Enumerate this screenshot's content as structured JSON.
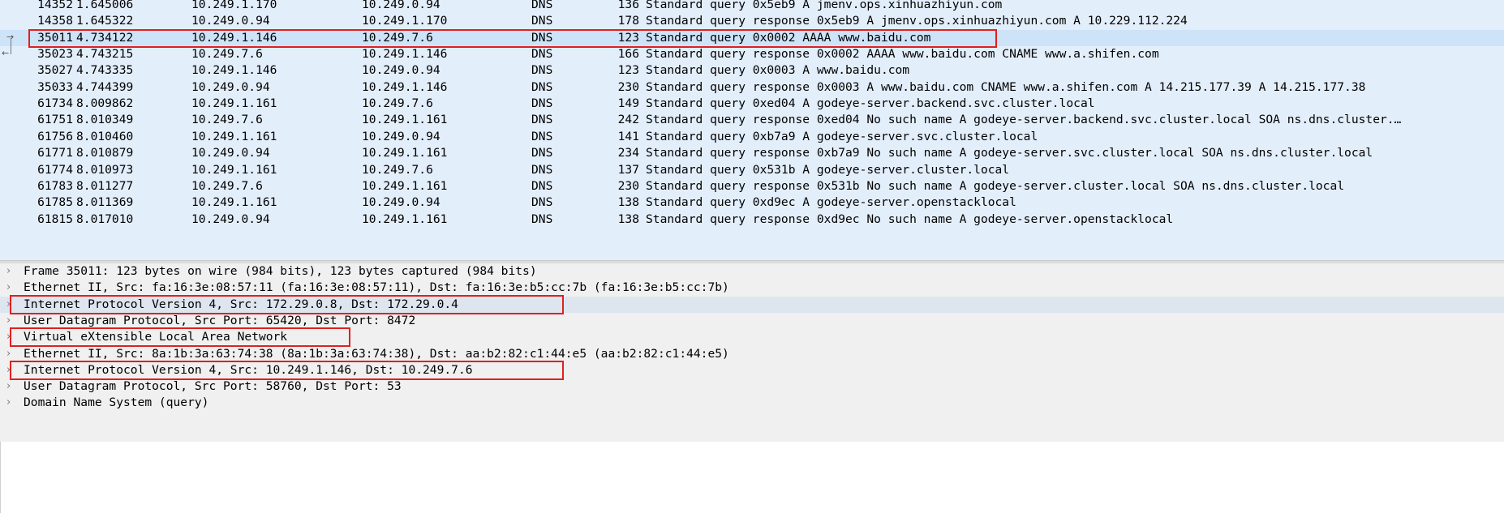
{
  "packet_list": {
    "rows": [
      {
        "no": "14352",
        "time": "1.645006",
        "src": "10.249.1.170",
        "dst": "10.249.0.94",
        "proto": "DNS",
        "len": "136",
        "info": "Standard query 0x5eb9 A jmenv.ops.xinhuazhiyun.com"
      },
      {
        "no": "14358",
        "time": "1.645322",
        "src": "10.249.0.94",
        "dst": "10.249.1.170",
        "proto": "DNS",
        "len": "178",
        "info": "Standard query response 0x5eb9 A jmenv.ops.xinhuazhiyun.com A 10.229.112.224"
      },
      {
        "no": "35011",
        "time": "4.734122",
        "src": "10.249.1.146",
        "dst": "10.249.7.6",
        "proto": "DNS",
        "len": "123",
        "info": "Standard query 0x0002 AAAA www.baidu.com",
        "selected": true
      },
      {
        "no": "35023",
        "time": "4.743215",
        "src": "10.249.7.6",
        "dst": "10.249.1.146",
        "proto": "DNS",
        "len": "166",
        "info": "Standard query response 0x0002 AAAA www.baidu.com CNAME www.a.shifen.com"
      },
      {
        "no": "35027",
        "time": "4.743335",
        "src": "10.249.1.146",
        "dst": "10.249.0.94",
        "proto": "DNS",
        "len": "123",
        "info": "Standard query 0x0003 A www.baidu.com"
      },
      {
        "no": "35033",
        "time": "4.744399",
        "src": "10.249.0.94",
        "dst": "10.249.1.146",
        "proto": "DNS",
        "len": "230",
        "info": "Standard query response 0x0003 A www.baidu.com CNAME www.a.shifen.com A 14.215.177.39 A 14.215.177.38"
      },
      {
        "no": "61734",
        "time": "8.009862",
        "src": "10.249.1.161",
        "dst": "10.249.7.6",
        "proto": "DNS",
        "len": "149",
        "info": "Standard query 0xed04 A godeye-server.backend.svc.cluster.local"
      },
      {
        "no": "61751",
        "time": "8.010349",
        "src": "10.249.7.6",
        "dst": "10.249.1.161",
        "proto": "DNS",
        "len": "242",
        "info": "Standard query response 0xed04 No such name A godeye-server.backend.svc.cluster.local SOA ns.dns.cluster.…"
      },
      {
        "no": "61756",
        "time": "8.010460",
        "src": "10.249.1.161",
        "dst": "10.249.0.94",
        "proto": "DNS",
        "len": "141",
        "info": "Standard query 0xb7a9 A godeye-server.svc.cluster.local"
      },
      {
        "no": "61771",
        "time": "8.010879",
        "src": "10.249.0.94",
        "dst": "10.249.1.161",
        "proto": "DNS",
        "len": "234",
        "info": "Standard query response 0xb7a9 No such name A godeye-server.svc.cluster.local SOA ns.dns.cluster.local"
      },
      {
        "no": "61774",
        "time": "8.010973",
        "src": "10.249.1.161",
        "dst": "10.249.7.6",
        "proto": "DNS",
        "len": "137",
        "info": "Standard query 0x531b A godeye-server.cluster.local"
      },
      {
        "no": "61783",
        "time": "8.011277",
        "src": "10.249.7.6",
        "dst": "10.249.1.161",
        "proto": "DNS",
        "len": "230",
        "info": "Standard query response 0x531b No such name A godeye-server.cluster.local SOA ns.dns.cluster.local"
      },
      {
        "no": "61785",
        "time": "8.011369",
        "src": "10.249.1.161",
        "dst": "10.249.0.94",
        "proto": "DNS",
        "len": "138",
        "info": "Standard query 0xd9ec A godeye-server.openstacklocal"
      },
      {
        "no": "61815",
        "time": "8.017010",
        "src": "10.249.0.94",
        "dst": "10.249.1.161",
        "proto": "DNS",
        "len": "138",
        "info": "Standard query response 0xd9ec No such name A godeye-server.openstacklocal"
      }
    ],
    "relation_icons": {
      "request_arrow": "→",
      "response_arrow": "←"
    }
  },
  "details": {
    "rows": [
      {
        "text": "Frame 35011: 123 bytes on wire (984 bits), 123 bytes captured (984 bits)"
      },
      {
        "text": "Ethernet II, Src: fa:16:3e:08:57:11 (fa:16:3e:08:57:11), Dst: fa:16:3e:b5:cc:7b (fa:16:3e:b5:cc:7b)"
      },
      {
        "text": "Internet Protocol Version 4, Src: 172.29.0.8, Dst: 172.29.0.4",
        "highlighted": true
      },
      {
        "text": "User Datagram Protocol, Src Port: 65420, Dst Port: 8472"
      },
      {
        "text": "Virtual eXtensible Local Area Network"
      },
      {
        "text": "Ethernet II, Src: 8a:1b:3a:63:74:38 (8a:1b:3a:63:74:38), Dst: aa:b2:82:c1:44:e5 (aa:b2:82:c1:44:e5)"
      },
      {
        "text": "Internet Protocol Version 4, Src: 10.249.1.146, Dst: 10.249.7.6"
      },
      {
        "text": "User Datagram Protocol, Src Port: 58760, Dst Port: 53"
      },
      {
        "text": "Domain Name System (query)"
      }
    ],
    "chevron": "›"
  },
  "colors": {
    "list_bg": "#e3eefb",
    "selected_row": "#cde3f8",
    "annotation": "#e02020",
    "details_bg": "#f0f0f0"
  }
}
